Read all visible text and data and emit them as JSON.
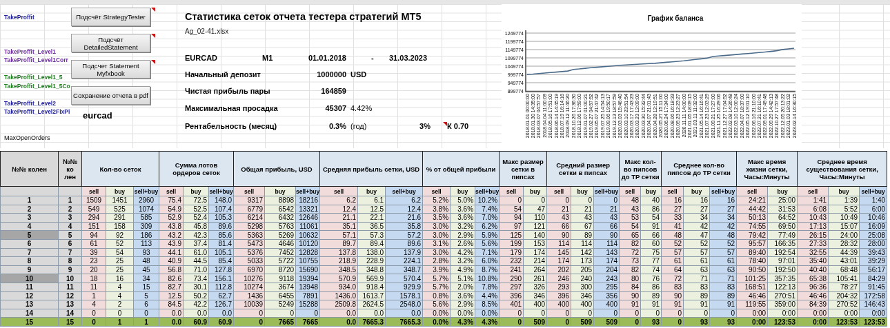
{
  "left_labels": [
    {
      "text": "TakeProffit",
      "color": "#1f1f9f"
    },
    {
      "text": "TakeProffit_Level1",
      "color": "#7030a0"
    },
    {
      "text": "TakeProffit_Level1Corr",
      "color": "#7030a0"
    },
    {
      "text": "TakeProffit_Level1_5",
      "color": "#238023"
    },
    {
      "text": "TakeProffit_Level1_5Co",
      "color": "#238023"
    },
    {
      "text": "TakeProffit_Level2",
      "color": "#1f1f9f"
    },
    {
      "text": "TakeProffit_Level2FixPi",
      "color": "#1f1f9f"
    }
  ],
  "max_open_orders_label": "MaxOpenOrders",
  "buttons": [
    {
      "label": "Подсчёт StrategyTester",
      "comment": true
    },
    {
      "label": "Подсчёт DetailedStatement",
      "comment": true
    },
    {
      "label": "Подсчет Statement Myfxbook",
      "comment": true
    },
    {
      "label": "Сохранение отчета в pdf",
      "comment": false
    }
  ],
  "sheet_name": "eurcad",
  "report": {
    "title": "Статистика сеток отчета тестера стратегий МТ5",
    "file": "Ag_02-41.xlsx",
    "pair": "EURCAD",
    "timeframe": "M1",
    "date_from": "01.01.2018",
    "date_separator": "-",
    "date_to": "31.03.2023",
    "stats": [
      {
        "label": "Начальный депозит",
        "value": "1000000",
        "unit": "USD"
      },
      {
        "label": "Чистая прибыль пары",
        "value": "164859"
      },
      {
        "label": "Максимальная просадка",
        "value": "45307",
        "percent": "4.42%"
      }
    ],
    "profitability": {
      "label": "Рентабельность (месяц)",
      "month": "0.3%",
      "year_label": "(год)",
      "year": "3%",
      "ratio": "К 0.70",
      "comment": true
    }
  },
  "chart": {
    "chart_data": {
      "type": "line",
      "title": "График баланса",
      "grid": true,
      "ylim": [
        899774,
        1249774
      ],
      "yticks": [
        899774,
        949774,
        999774,
        1049774,
        1099774,
        1149774,
        1199774,
        1249774
      ],
      "categories": [
        "2018.01.01 00:00:00",
        "2018.01.30 14:35:00",
        "2018.03.07 04:57:57",
        "2018.04.04 11:00:09",
        "2018.05.16 17:51:00",
        "2018.06.14 14:45:19",
        "2018.07.19 16:14:16",
        "2018.09.12 11:46:20",
        "2018.10.26 17:36:30",
        "2018.12.06 17:59:00",
        "2019.01.07 01:00:21",
        "2019.02.27 04:57:52",
        "2019.05.07 21:47:42",
        "2019.07.25 14:54:13",
        "2019.09.06 19:50:17",
        "2019.12.13 18:57:59",
        "2020.03.03 15:46:40",
        "2020.03.10 23:51:54",
        "2020.03.17 17:43:23",
        "2020.03.23 12:09:00",
        "2020.03.30 15:32:44",
        "2020.04.07 21:01:43",
        "2020.04.28 12:19:51",
        "2020.05.27 15:11:00",
        "2020.06.24 17:34:00",
        "2020.08.06 16:18:33",
        "2020.09.23 12:23:27",
        "2020.11.11 14:00:00",
        "2021.01.05 18:09:15",
        "2021.03.11 11:32:00",
        "2021.05.14 16:16:41",
        "2021.07.23 12:03:29",
        "2021.09.21 17:27:00",
        "2021.11.25 16:29:06",
        "2021.12.27 17:04:52",
        "2022.02.08 14:26:48",
        "2022.03.10 12:00:24",
        "2022.04.07 18:37:00",
        "2022.05.12 19:01:10",
        "2022.06.16 21:10:00",
        "2022.07.21 16:10:41",
        "2022.09.01 17:49:48",
        "2022.09.29 14:42:13",
        "2022.10.27 17:57:48",
        "2022.12.05 20:13:22",
        "2023.01.03 18:01:02",
        "2023.02.14 16:30:15"
      ],
      "series": [
        {
          "color": "#4a6a8a",
          "values": [
            1000000,
            1002000,
            1005000,
            1008000,
            1011000,
            1014000,
            1017000,
            1020000,
            1030000,
            1033000,
            1037000,
            1040000,
            1043000,
            1046000,
            1049000,
            1052000,
            1055000,
            1057000,
            1059000,
            1061000,
            1063000,
            1065000,
            1067000,
            1070000,
            1073000,
            1076000,
            1079000,
            1082000,
            1086000,
            1090000,
            1094000,
            1098000,
            1108000,
            1111000,
            1114000,
            1117000,
            1120000,
            1123000,
            1126000,
            1129000,
            1132000,
            1135000,
            1139000,
            1143000,
            1150000,
            1154000,
            1158000
          ]
        }
      ]
    }
  },
  "table": {
    "header_groups": [
      {
        "title": "№№ колен"
      },
      {
        "title": "№№ ко лен"
      },
      {
        "title": "Кол-во сеток",
        "sub": [
          {
            "label": "sell",
            "kind": "sell"
          },
          {
            "label": "buy",
            "kind": "buy"
          },
          {
            "label": "sell+buy",
            "kind": "sum"
          }
        ]
      },
      {
        "title": "Сумма лотов ордеров сеток",
        "sub": [
          {
            "label": "sell",
            "kind": "sell"
          },
          {
            "label": "buy",
            "kind": "buy"
          },
          {
            "label": "sell+buy",
            "kind": "sum"
          }
        ]
      },
      {
        "title": "Общая прибыль, USD",
        "sub": [
          {
            "label": "sell",
            "kind": "sell"
          },
          {
            "label": "buy",
            "kind": "buy"
          },
          {
            "label": "sell+buy",
            "kind": "sum"
          }
        ]
      },
      {
        "title": "Средняя прибыль сетки, USD",
        "sub": [
          {
            "label": "sell",
            "kind": "sell"
          },
          {
            "label": "buy",
            "kind": "buy"
          },
          {
            "label": "sell+buy",
            "kind": "sum"
          }
        ]
      },
      {
        "title": "% от общей прибыли",
        "sub": [
          {
            "label": "sell",
            "kind": "sell"
          },
          {
            "label": "buy",
            "kind": "buy"
          },
          {
            "label": "sell+buy",
            "kind": "sum"
          }
        ]
      },
      {
        "title": "Макс размер сетки в пипсах",
        "sub": [
          {
            "label": "sell",
            "kind": "sell"
          },
          {
            "label": "buy",
            "kind": "buy"
          }
        ]
      },
      {
        "title": "Средний размер сетки в пипсах",
        "sub": [
          {
            "label": "sell",
            "kind": "sell"
          },
          {
            "label": "buy",
            "kind": "buy"
          },
          {
            "label": "sell+buy",
            "kind": "sum"
          }
        ]
      },
      {
        "title": "Макс кол-во пипсов до TP сетки",
        "sub": [
          {
            "label": "sell",
            "kind": "sell"
          },
          {
            "label": "buy",
            "kind": "buy"
          }
        ]
      },
      {
        "title": "Среднее кол-во пипсов до TP сетки",
        "sub": [
          {
            "label": "sell",
            "kind": "sell"
          },
          {
            "label": "buy",
            "kind": "buy"
          },
          {
            "label": "sell+buy",
            "kind": "sum"
          }
        ]
      },
      {
        "title": "Макс время жизни сетки, Часы:Минуты",
        "sub": [
          {
            "label": "sell",
            "kind": "sell"
          },
          {
            "label": "buy",
            "kind": "buy"
          }
        ]
      },
      {
        "title": "Среднее время существования сетки, Часы:Минуты",
        "sub": [
          {
            "label": "sell",
            "kind": "sell"
          },
          {
            "label": "buy",
            "kind": "buy"
          },
          {
            "label": "sell+buy",
            "kind": "sum"
          }
        ]
      }
    ],
    "rows": [
      {
        "highlighted": false,
        "shaded": false,
        "cells": [
          "1",
          "1",
          "1509",
          "1451",
          "2960",
          "75.4",
          "72.5",
          "148.0",
          "9317",
          "8898",
          "18216",
          "6.2",
          "6.1",
          "6.2",
          "5.2%",
          "5.0%",
          "10.2%",
          "0",
          "0",
          "0",
          "0",
          "0",
          "48",
          "40",
          "16",
          "16",
          "16",
          "24:21",
          "25:00",
          "1:41",
          "1:39",
          "1:40"
        ]
      },
      {
        "highlighted": false,
        "shaded": false,
        "cells": [
          "2",
          "2",
          "549",
          "525",
          "1074",
          "54.9",
          "52.5",
          "107.4",
          "6779",
          "6542",
          "13321",
          "12.4",
          "12.5",
          "12.4",
          "3.8%",
          "3.6%",
          "7.4%",
          "54",
          "47",
          "21",
          "21",
          "21",
          "43",
          "86",
          "27",
          "27",
          "27",
          "44:42",
          "31:53",
          "6:08",
          "5:52",
          "6:00"
        ]
      },
      {
        "highlighted": false,
        "shaded": false,
        "cells": [
          "3",
          "3",
          "294",
          "291",
          "585",
          "52.9",
          "52.4",
          "105.3",
          "6214",
          "6432",
          "12646",
          "21.1",
          "22.1",
          "21.6",
          "3.5%",
          "3.6%",
          "7.0%",
          "94",
          "110",
          "43",
          "43",
          "43",
          "53",
          "54",
          "33",
          "34",
          "34",
          "50:13",
          "64:52",
          "10:43",
          "10:49",
          "10:46"
        ]
      },
      {
        "highlighted": false,
        "shaded": false,
        "cells": [
          "4",
          "4",
          "151",
          "158",
          "309",
          "43.8",
          "45.8",
          "89.6",
          "5298",
          "5763",
          "11061",
          "35.1",
          "36.5",
          "35.8",
          "3.0%",
          "3.2%",
          "6.2%",
          "97",
          "121",
          "66",
          "67",
          "66",
          "54",
          "91",
          "41",
          "42",
          "42",
          "74:55",
          "69:50",
          "17:13",
          "15:07",
          "16:09"
        ]
      },
      {
        "highlighted": false,
        "shaded": true,
        "cells": [
          "5",
          "5",
          "94",
          "92",
          "186",
          "43.2",
          "42.3",
          "85.6",
          "5363",
          "5269",
          "10632",
          "57.1",
          "57.3",
          "57.2",
          "3.0%",
          "2.9%",
          "5.9%",
          "125",
          "140",
          "90",
          "89",
          "90",
          "65",
          "66",
          "48",
          "47",
          "48",
          "79:42",
          "77:49",
          "26:15",
          "24:00",
          "25:08"
        ]
      },
      {
        "highlighted": false,
        "shaded": false,
        "cells": [
          "6",
          "6",
          "61",
          "52",
          "113",
          "43.9",
          "37.4",
          "81.4",
          "5473",
          "4646",
          "10120",
          "89.7",
          "89.4",
          "89.6",
          "3.1%",
          "2.6%",
          "5.6%",
          "199",
          "153",
          "114",
          "114",
          "114",
          "82",
          "60",
          "52",
          "52",
          "52",
          "95:57",
          "166:35",
          "27:33",
          "28:32",
          "28:00"
        ]
      },
      {
        "highlighted": false,
        "shaded": false,
        "cells": [
          "7",
          "7",
          "39",
          "54",
          "93",
          "44.1",
          "61.0",
          "105.1",
          "5376",
          "7452",
          "12828",
          "137.8",
          "138.0",
          "137.9",
          "3.0%",
          "4.2%",
          "7.1%",
          "179",
          "174",
          "145",
          "142",
          "143",
          "72",
          "75",
          "57",
          "57",
          "57",
          "89:40",
          "192:54",
          "32:55",
          "44:39",
          "39:43"
        ]
      },
      {
        "highlighted": false,
        "shaded": false,
        "cells": [
          "8",
          "8",
          "23",
          "25",
          "48",
          "40.9",
          "44.5",
          "85.4",
          "5033",
          "5722",
          "10755",
          "218.9",
          "228.9",
          "224.1",
          "2.8%",
          "3.2%",
          "6.0%",
          "232",
          "214",
          "174",
          "173",
          "174",
          "73",
          "77",
          "61",
          "61",
          "61",
          "78:40",
          "97:01",
          "35:40",
          "43:01",
          "39:29"
        ]
      },
      {
        "highlighted": false,
        "shaded": false,
        "cells": [
          "9",
          "9",
          "20",
          "25",
          "45",
          "56.8",
          "71.0",
          "127.8",
          "6970",
          "8720",
          "15690",
          "348.5",
          "348.8",
          "348.7",
          "3.9%",
          "4.9%",
          "8.7%",
          "241",
          "264",
          "202",
          "205",
          "204",
          "82",
          "74",
          "64",
          "63",
          "63",
          "90:50",
          "192:50",
          "40:40",
          "68:48",
          "56:17"
        ]
      },
      {
        "highlighted": false,
        "shaded": true,
        "cells": [
          "10",
          "10",
          "18",
          "16",
          "34",
          "82.6",
          "73.4",
          "156.1",
          "10276",
          "9118",
          "19394",
          "570.9",
          "569.9",
          "570.4",
          "5.7%",
          "5.1%",
          "10.8%",
          "290",
          "261",
          "246",
          "240",
          "243",
          "80",
          "76",
          "72",
          "71",
          "71",
          "101:25",
          "357:35",
          "65:38",
          "105:41",
          "84:29"
        ]
      },
      {
        "highlighted": false,
        "shaded": false,
        "cells": [
          "11",
          "11",
          "11",
          "4",
          "15",
          "82.7",
          "30.1",
          "112.8",
          "10274",
          "3674",
          "13948",
          "934.0",
          "918.4",
          "929.9",
          "5.7%",
          "2.0%",
          "7.8%",
          "297",
          "326",
          "293",
          "300",
          "295",
          "84",
          "86",
          "83",
          "83",
          "83",
          "168:51",
          "122:13",
          "96:36",
          "78:27",
          "91:45"
        ]
      },
      {
        "highlighted": false,
        "shaded": false,
        "cells": [
          "12",
          "12",
          "1",
          "4",
          "5",
          "12.5",
          "50.2",
          "62.7",
          "1436",
          "6455",
          "7891",
          "1436.0",
          "1613.7",
          "1578.1",
          "0.8%",
          "3.6%",
          "4.4%",
          "396",
          "346",
          "396",
          "346",
          "356",
          "90",
          "89",
          "90",
          "89",
          "89",
          "46:46",
          "270:51",
          "46:46",
          "204:32",
          "172:58"
        ]
      },
      {
        "highlighted": false,
        "shaded": false,
        "cells": [
          "13",
          "13",
          "4",
          "2",
          "6",
          "84.5",
          "42.2",
          "126.7",
          "10039",
          "5249",
          "15288",
          "2509.8",
          "2624.5",
          "2548.0",
          "5.6%",
          "2.9%",
          "8.5%",
          "401",
          "400",
          "400",
          "400",
          "400",
          "91",
          "91",
          "91",
          "91",
          "91",
          "119:55",
          "359:00",
          "84:39",
          "270:52",
          "146:43"
        ]
      },
      {
        "highlighted": false,
        "shaded": false,
        "cells": [
          "14",
          "14",
          "0",
          "0",
          "0",
          "0.0",
          "0.0",
          "0.0",
          "0",
          "0",
          "0",
          "0.0",
          "0.0",
          "0.0",
          "0.0%",
          "0.0%",
          "0.0%",
          "0",
          "0",
          "0",
          "0",
          "0",
          "0",
          "0",
          "0",
          "0",
          "0",
          "0:00",
          "0:00",
          "0:00",
          "0:00",
          "0:00"
        ]
      },
      {
        "highlighted": true,
        "shaded": false,
        "cells": [
          "15",
          "15",
          "0",
          "1",
          "1",
          "0.0",
          "60.9",
          "60.9",
          "0",
          "7665",
          "7665",
          "0.0",
          "7665.3",
          "7665.3",
          "0.0%",
          "4.3%",
          "4.3%",
          "0",
          "509",
          "0",
          "509",
          "509",
          "0",
          "93",
          "0",
          "93",
          "93",
          "0:00",
          "123:53",
          "0:00",
          "123:53",
          "123:53"
        ]
      }
    ]
  }
}
